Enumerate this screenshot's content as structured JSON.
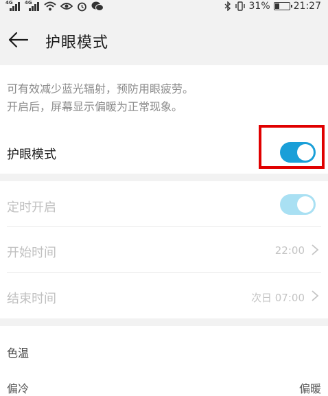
{
  "status_bar": {
    "signal1_tag": "4G",
    "signal2_tag": "4G",
    "battery_percent": "31%",
    "battery_level": 0.31,
    "time": "21:27",
    "icons": [
      "signal-icon",
      "signal-icon",
      "wifi-icon",
      "eye-icon",
      "alarm-icon",
      "wechat-icon",
      "bluetooth-icon",
      "vibrate-icon",
      "battery-icon"
    ]
  },
  "header": {
    "title": "护眼模式",
    "back_icon": "arrow-left-icon"
  },
  "description": {
    "line1": "可有效减少蓝光辐射，预防用眼疲劳。",
    "line2": "开启后，屏幕显示偏暖为正常现象。"
  },
  "eye_mode": {
    "label": "护眼模式",
    "enabled": true
  },
  "schedule": {
    "label": "定时开启",
    "enabled": true,
    "start": {
      "label": "开始时间",
      "value": "22:00"
    },
    "end": {
      "label": "结束时间",
      "value": "次日 07:00"
    }
  },
  "color_temp": {
    "label": "色温",
    "left_label": "偏冷",
    "right_label": "偏暖"
  },
  "colors": {
    "accent": "#1a9fd8",
    "accent_dim": "#a9e0f3",
    "highlight": "#e00000"
  }
}
